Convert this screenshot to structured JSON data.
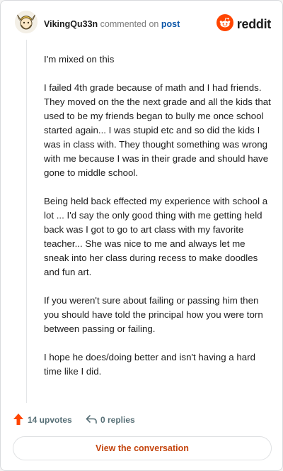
{
  "header": {
    "username": "VikingQu33n",
    "action_text": "commented on",
    "post_link": "post",
    "brand_name": "reddit",
    "avatar_icon": "viking-avatar-icon",
    "logo_icon": "reddit-logo-icon"
  },
  "comment": {
    "paragraphs": [
      "I'm mixed on this",
      "I failed 4th grade because of math and I had friends. They moved on the the next grade and all the kids that used to be my friends began to bully me once school started again... I was stupid etc and so did the kids I was in class with. They thought something was wrong with me because I was in their grade and should have gone to middle school.",
      "Being held back effected my experience with school a lot ... I'd say the only good thing with me getting held back was I got to go to art class with my favorite teacher... She was nice to me and always let me sneak into her class during recess to make doodles and fun art.",
      "If you weren't sure about failing or passing him then you should have told the principal how you were torn between passing or failing.",
      "I hope he does/doing better and isn't having a hard time like I did."
    ]
  },
  "actions": {
    "upvotes_label": "14 upvotes",
    "replies_label": "0 replies"
  },
  "footer": {
    "view_conversation_label": "View the conversation"
  },
  "colors": {
    "brand_orange": "#ff4500",
    "link_blue": "#0b56a8",
    "cta_orange": "#c4440d",
    "action_gray": "#576f76"
  }
}
